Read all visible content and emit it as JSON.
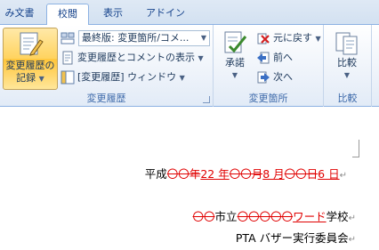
{
  "tabs": [
    {
      "label": "み文書",
      "active": false
    },
    {
      "label": "校閲",
      "active": true
    },
    {
      "label": "表示",
      "active": false
    },
    {
      "label": "アドイン",
      "active": false
    }
  ],
  "track_group": {
    "label": "変更履歴",
    "track_changes_line1": "変更履歴の",
    "track_changes_line2": "記録",
    "display_combo": "最終版: 変更箇所/コメ...",
    "show_markup": "変更履歴とコメントの表示",
    "reviewing_pane": "[変更履歴] ウィンドウ"
  },
  "changes_group": {
    "label": "変更箇所",
    "accept": "承諾",
    "reject": "元に戻す",
    "previous": "前へ",
    "next": "次へ"
  },
  "compare_group": {
    "label": "比較",
    "compare": "比較"
  },
  "document": {
    "line1": [
      {
        "text": "平成",
        "type": "normal"
      },
      {
        "text": "〇〇年",
        "type": "del"
      },
      {
        "text": "22 年",
        "type": "ins"
      },
      {
        "text": "〇〇月",
        "type": "del"
      },
      {
        "text": "8 月",
        "type": "ins"
      },
      {
        "text": "〇〇日",
        "type": "del"
      },
      {
        "text": "6 日",
        "type": "ins"
      }
    ],
    "line2": [
      {
        "text": "〇〇",
        "type": "del"
      },
      {
        "text": "市立",
        "type": "normal"
      },
      {
        "text": "〇〇〇〇〇",
        "type": "del"
      },
      {
        "text": "ワード",
        "type": "ins"
      },
      {
        "text": "学校",
        "type": "normal"
      }
    ],
    "line3": [
      {
        "text": "PTA バザー実行委員会",
        "type": "normal"
      }
    ],
    "paragraph_mark": "↵"
  },
  "colors": {
    "revision": "#e00000",
    "ribbon_text": "#1e395b",
    "group_label": "#3e6aaa"
  }
}
